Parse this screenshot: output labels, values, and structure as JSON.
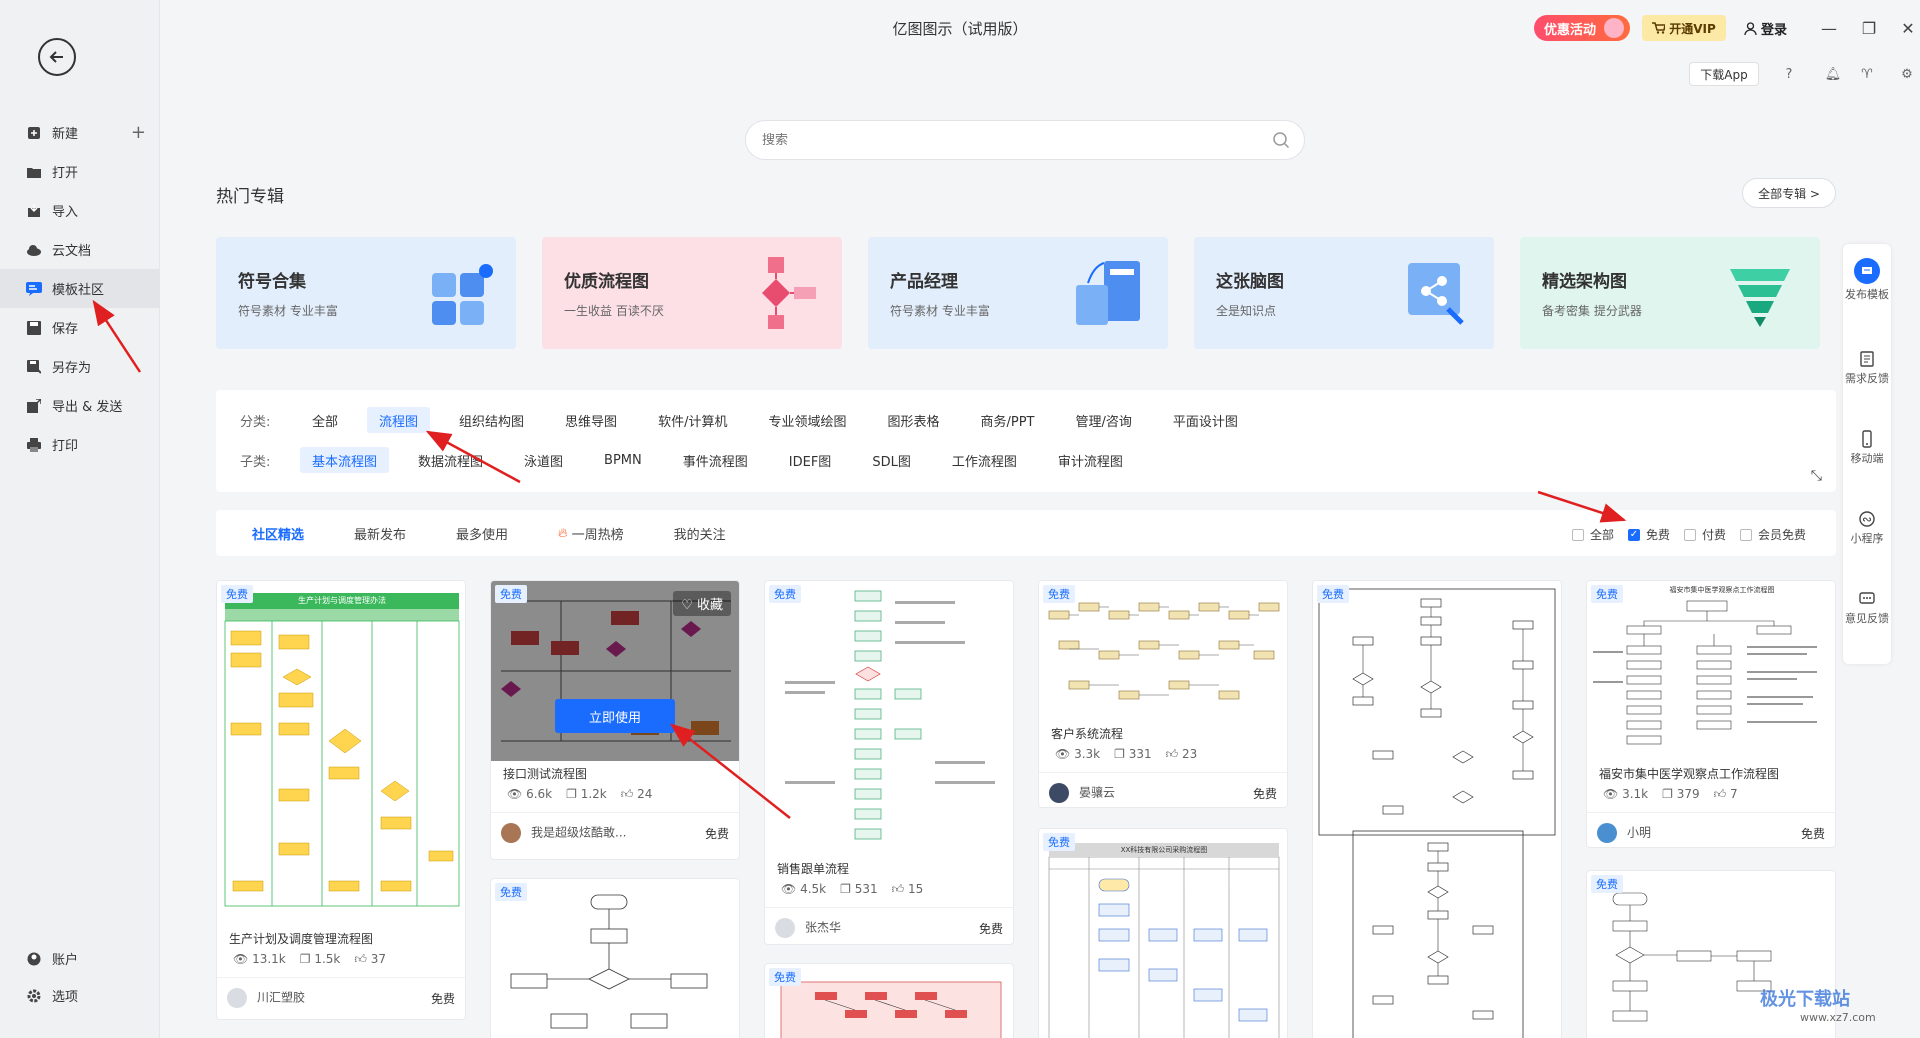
{
  "window": {
    "title": "亿图图示（试用版）",
    "promo_label": "优惠活动",
    "vip_label": "开通VIP",
    "login_label": "登录",
    "download_app": "下载App"
  },
  "sidebar": {
    "items": [
      {
        "label": "新建",
        "icon": "plus-square-icon"
      },
      {
        "label": "打开",
        "icon": "folder-icon"
      },
      {
        "label": "导入",
        "icon": "import-icon"
      },
      {
        "label": "云文档",
        "icon": "cloud-icon"
      },
      {
        "label": "模板社区",
        "icon": "template-icon"
      },
      {
        "label": "保存",
        "icon": "save-icon"
      },
      {
        "label": "另存为",
        "icon": "save-as-icon"
      },
      {
        "label": "导出 & 发送",
        "icon": "export-icon"
      },
      {
        "label": "打印",
        "icon": "print-icon"
      }
    ],
    "bottom": [
      {
        "label": "账户",
        "icon": "account-icon"
      },
      {
        "label": "选项",
        "icon": "gear-icon"
      }
    ]
  },
  "search": {
    "placeholder": "搜索"
  },
  "hot_albums": {
    "title": "热门专辑",
    "all_label": "全部专辑 >",
    "items": [
      {
        "title": "符号合集",
        "subtitle": "符号素材 专业丰富",
        "bg": "#e3eefc"
      },
      {
        "title": "优质流程图",
        "subtitle": "一生收益 百读不厌",
        "bg": "#fde0e6"
      },
      {
        "title": "产品经理",
        "subtitle": "符号素材 专业丰富",
        "bg": "#e3eefc"
      },
      {
        "title": "这张脑图",
        "subtitle": "全是知识点",
        "bg": "#e3eefc"
      },
      {
        "title": "精选架构图",
        "subtitle": "备考密集 提分武器",
        "bg": "#dff5ee"
      }
    ]
  },
  "filters": {
    "category_label": "分类:",
    "categories": [
      "全部",
      "流程图",
      "组织结构图",
      "思维导图",
      "软件/计算机",
      "专业领域绘图",
      "图形表格",
      "商务/PPT",
      "管理/咨询",
      "平面设计图"
    ],
    "selected_category": "流程图",
    "subcategory_label": "子类:",
    "subcategories": [
      "基本流程图",
      "数据流程图",
      "泳道图",
      "BPMN",
      "事件流程图",
      "IDEF图",
      "SDL图",
      "工作流程图",
      "审计流程图"
    ],
    "selected_subcategory": "基本流程图"
  },
  "tabs": {
    "items": [
      "社区精选",
      "最新发布",
      "最多使用",
      "一周热榜",
      "我的关注"
    ],
    "selected": "社区精选",
    "price_filters": [
      {
        "label": "全部",
        "checked": false
      },
      {
        "label": "免费",
        "checked": true
      },
      {
        "label": "付费",
        "checked": false
      },
      {
        "label": "会员免费",
        "checked": false
      }
    ]
  },
  "cards": {
    "badge": "免费",
    "fav_label": "收藏",
    "use_label": "立即使用",
    "c1": {
      "name": "生产计划及调度管理流程图",
      "views": "13.1k",
      "copies": "1.5k",
      "likes": "37",
      "author": "川汇塑胶",
      "price": "免费",
      "header": "生产计划与调度管理办法"
    },
    "c2": {
      "name": "接口测试流程图",
      "views": "6.6k",
      "copies": "1.2k",
      "likes": "24",
      "author": "我是超级炫酷敢...",
      "price": "免费"
    },
    "c3": {
      "name": "销售跟单流程",
      "views": "4.5k",
      "copies": "531",
      "likes": "15",
      "author": "张杰华",
      "price": "免费"
    },
    "c4": {
      "name": "客户系统流程",
      "views": "3.3k",
      "copies": "331",
      "likes": "23",
      "author": "晏骧云",
      "price": "免费"
    },
    "c6": {
      "name": "福安市集中医学观察点工作流程图",
      "views": "3.1k",
      "copies": "379",
      "likes": "7",
      "author": "小明",
      "price": "免费",
      "header": "福安市集中医学观察点工作流程图"
    },
    "c9": {
      "header": "XX科技有限公司采购流程图"
    }
  },
  "right_rail": [
    {
      "label": "发布模板"
    },
    {
      "label": "需求反馈"
    },
    {
      "label": "移动端"
    },
    {
      "label": "小程序"
    },
    {
      "label": "意见反馈"
    }
  ],
  "watermark": {
    "text": "极光下载站",
    "url": "www.xz7.com"
  },
  "colors": {
    "accent": "#1a6cff",
    "arrow": "#e02020",
    "promo": "#ff4d6d"
  }
}
